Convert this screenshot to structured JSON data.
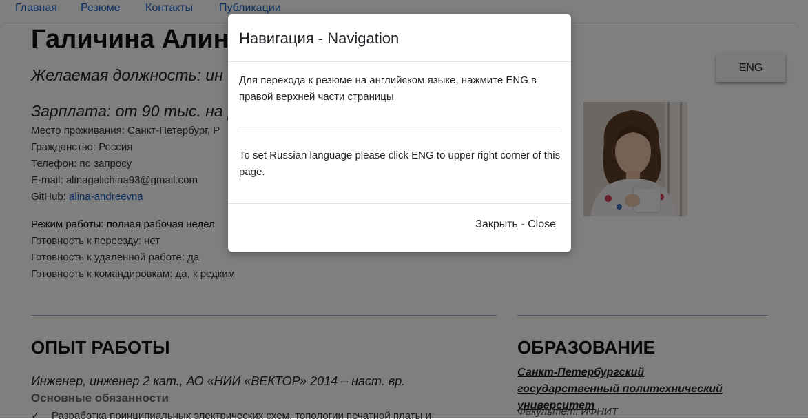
{
  "nav": {
    "items": [
      "Главная",
      "Резюме",
      "Контакты",
      "Публикации"
    ]
  },
  "resume": {
    "name": "Галичина Алин",
    "desired": "Желаемая должность: ин",
    "salary": "Зарплата: от 90 тыс. на ру",
    "residence": "Место проживания: Санкт-Петербург, Р",
    "citizenship": "Гражданство: Россия",
    "phone": "Телефон: по запросу",
    "email": "E-mail: alinagalichina93@gmail.com",
    "github_label": "GitHub: ",
    "github_link": "alina-andreevna",
    "work_mode": "Режим работы: полная рабочая недел",
    "relocation": "Готовность к переезду: нет",
    "remote": "Готовность к удалённой работе: да",
    "trips": "Готовность к командировкам: да, к редким"
  },
  "lang_button": "ENG",
  "experience": {
    "heading": "ОПЫТ РАБОТЫ",
    "job": "Инженер, инженер 2 кат., АО «НИИ «ВЕКТОР» 2014 – наст. вр.",
    "duties": "Основные обязанности",
    "bullet": "Разработка принципиальных электрических схем, топологии печатной платы и"
  },
  "education": {
    "heading": "ОБРАЗОВАНИЕ",
    "university": "Санкт-Петербургский государственный политехнический университет",
    "faculty": "Факультет: ИФНИТ"
  },
  "modal": {
    "title": "Навигация - Navigation",
    "text_ru": "Для перехода к резюме на английском языке, нажмите ENG в правой верхней части страницы",
    "text_en": "To set Russian language please click ENG to upper right corner of this page.",
    "close": "Закрыть - Close"
  },
  "colors": {
    "link": "#1a63c6",
    "overlay": "rgba(0,0,0,0.5)",
    "rule": "#9aa3c8"
  }
}
